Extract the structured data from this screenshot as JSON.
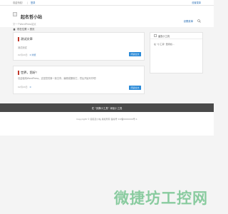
{
  "topbar": {
    "greeting": "欢迎光临！",
    "login": "登录",
    "right_link": "设置菜单"
  },
  "header": {
    "site_title": "起名哲小站",
    "tagline": "又一个WordPress站点",
    "right_link": "设置菜单"
  },
  "breadcrumb": {
    "text": "现在位置 » 首页"
  },
  "posts": [
    {
      "title": "测试文章",
      "excerpt": "测试测试",
      "date": "02月24日",
      "views": "0 浏览",
      "button": "阅读全文"
    },
    {
      "title": "世界，您好！",
      "excerpt": "欢迎使用WordPress。这是您的第一篇文章。编辑或删除它，然后开始写作吧！",
      "date": "02月24日",
      "views": "0",
      "button": "阅读全文"
    }
  ],
  "widget": {
    "title": "留言小工具",
    "body": "在 \"小工具\" 里添加..."
  },
  "footer": {
    "strip_text": "在 \"页脚小工具\" 添加小工具",
    "copyright": "Copyright © 起名哲小站 版权所有  备案号 ICP备0000000号-1"
  },
  "watermark": {
    "text": "微捷坊工控网",
    "sub": ""
  },
  "colors": {
    "accent": "#2a8ad8",
    "red_bar": "#c0392b",
    "footer_strip": "#4a4a4a"
  }
}
